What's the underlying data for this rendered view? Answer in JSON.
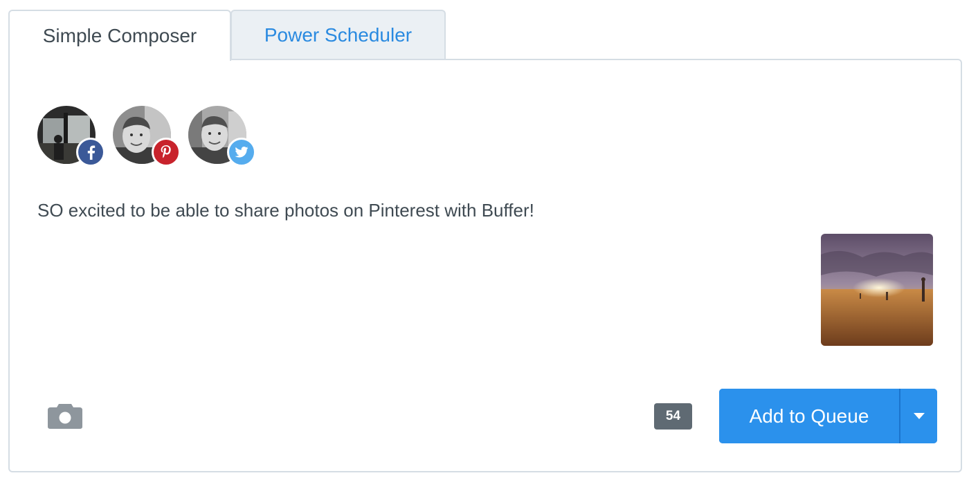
{
  "tabs": {
    "simple": "Simple Composer",
    "power": "Power Scheduler"
  },
  "profiles": [
    {
      "network": "facebook",
      "icon": "facebook-icon",
      "color": "#3b5998"
    },
    {
      "network": "pinterest",
      "icon": "pinterest-icon",
      "color": "#c8232c"
    },
    {
      "network": "twitter",
      "icon": "twitter-icon",
      "color": "#55acee"
    }
  ],
  "composer": {
    "message": "SO excited to be able to share photos on Pinterest with Buffer!"
  },
  "footer": {
    "camera_icon": "camera-icon",
    "char_count": "54",
    "queue_label": "Add to Queue",
    "dropdown_icon": "caret-down-icon"
  },
  "colors": {
    "accent": "#2b91ec",
    "link": "#2a8ae0",
    "border": "#d5dde4",
    "counter_bg": "#5f6a73"
  }
}
